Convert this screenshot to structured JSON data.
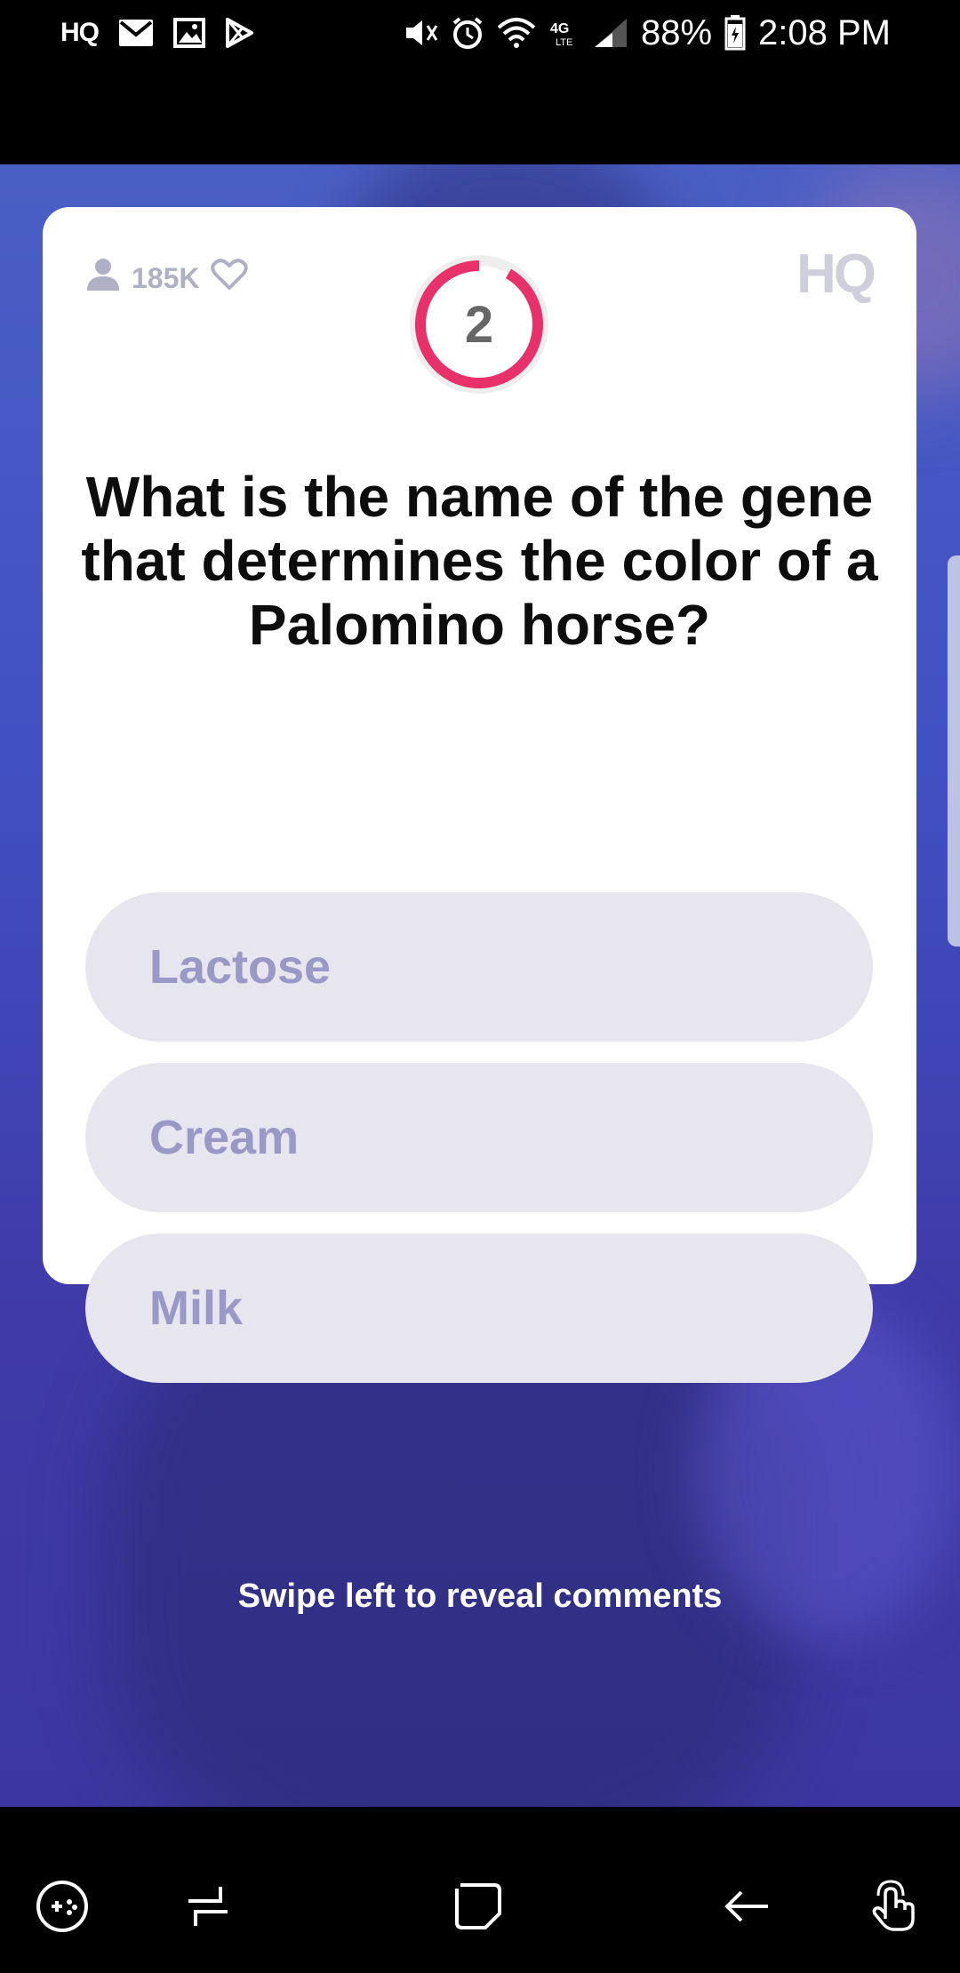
{
  "status_bar": {
    "app_badge": "HQ",
    "battery": "88%",
    "time": "2:08 PM",
    "network": "4G LTE",
    "icons": [
      "mail-icon",
      "image-icon",
      "play-store-icon",
      "mute-icon",
      "alarm-icon",
      "wifi-icon",
      "signal-icon",
      "battery-icon"
    ]
  },
  "card": {
    "viewer_count": "185K",
    "timer_value": "2",
    "logo": "HQ",
    "question": "What is the name of the gene that determines the color of a Palomino horse?",
    "options": [
      {
        "label": "Lactose"
      },
      {
        "label": "Cream"
      },
      {
        "label": "Milk"
      }
    ],
    "colors": {
      "timer_ring": "#e8306a",
      "option_bg": "#e7e6ee",
      "option_text": "#9a98c6"
    }
  },
  "footer": {
    "swipe_hint": "Swipe left to reveal comments"
  },
  "nav_bar": {
    "buttons": [
      "game-tools-icon",
      "recents-icon",
      "home-icon",
      "back-icon",
      "gesture-icon"
    ]
  }
}
